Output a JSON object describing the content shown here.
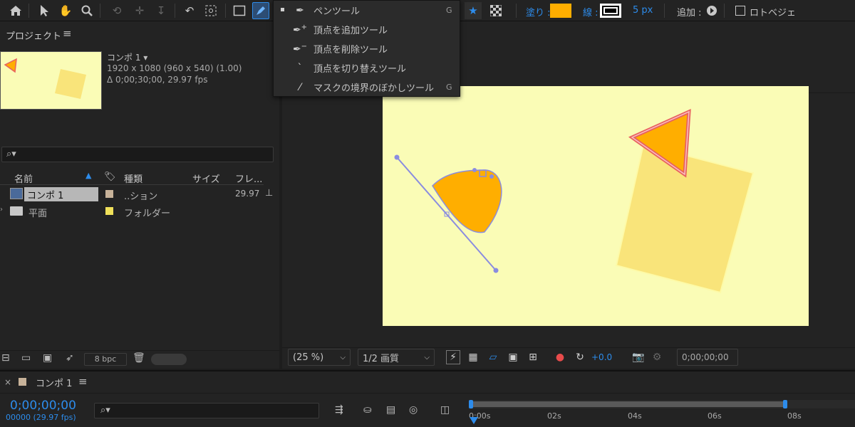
{
  "colors": {
    "fill": "#ffae00",
    "accent": "#2d8ceb",
    "canvas": "#fafcb6",
    "panel": "#232323"
  },
  "toolbar": {
    "icons": [
      "home-icon",
      "selection-icon",
      "hand-icon",
      "zoom-icon",
      "orbit-icon",
      "pan-icon",
      "dolly-icon",
      "rotate-icon",
      "anchor-icon",
      "rectangle-icon",
      "pen-icon"
    ],
    "fill_label": "塗り :",
    "stroke_label": "線 :",
    "stroke_width": "5 px",
    "add_label": "追加 :",
    "bezier_label": "ロトベジェ"
  },
  "menu": {
    "items": [
      {
        "label": "ペンツール",
        "shortcut": "G",
        "icon": "pen-icon"
      },
      {
        "label": "頂点を追加ツール",
        "shortcut": "",
        "icon": "add-vertex-icon"
      },
      {
        "label": "頂点を削除ツール",
        "shortcut": "",
        "icon": "delete-vertex-icon"
      },
      {
        "label": "頂点を切り替えツール",
        "shortcut": "",
        "icon": "convert-vertex-icon"
      },
      {
        "label": "マスクの境界のぼかしツール",
        "shortcut": "G",
        "icon": "feather-icon"
      }
    ]
  },
  "project": {
    "title": "プロジェクト",
    "comp_name": "コンポ 1 ▾",
    "comp_size": "1920 x 1080  (960 x 540) (1.00)",
    "comp_duration": "Δ 0;00;30;00, 29.97 fps",
    "columns": {
      "name": "名前",
      "type": "種類",
      "size": "サイズ",
      "frame": "フレ..."
    },
    "rows": [
      {
        "name": "コンポ 1",
        "type": "..ション",
        "frame": "29.97"
      },
      {
        "name": "平面",
        "type": "フォルダー",
        "frame": ""
      }
    ],
    "bpc": "8 bpc"
  },
  "viewer": {
    "zoom": "(25 %)",
    "quality": "1/2 画質",
    "exposure": "+0.0",
    "timecode": "0;00;00;00"
  },
  "timeline": {
    "comp_tab": "コンポ 1",
    "timecode": "0;00;00;00",
    "fps_line": "00000 (29.97 fps)",
    "ticks": [
      "0:00s",
      "02s",
      "04s",
      "06s",
      "08s"
    ]
  }
}
